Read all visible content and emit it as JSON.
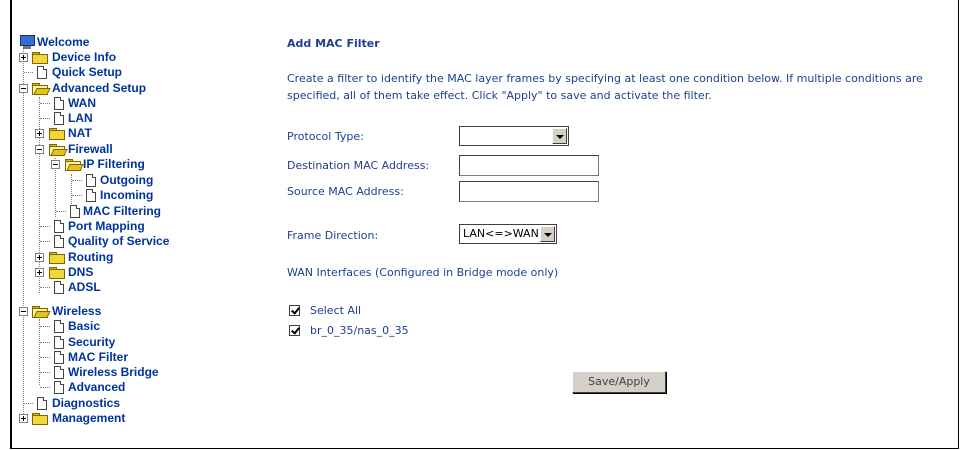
{
  "tree": {
    "welcome": "Welcome",
    "device_info": "Device Info",
    "quick_setup": "Quick Setup",
    "advanced_setup": "Advanced Setup",
    "wan": "WAN",
    "lan": "LAN",
    "nat": "NAT",
    "firewall": "Firewall",
    "ip_filtering": "IP Filtering",
    "outgoing": "Outgoing",
    "incoming": "Incoming",
    "mac_filtering": "MAC Filtering",
    "port_mapping": "Port Mapping",
    "qos": "Quality of Service",
    "routing": "Routing",
    "dns": "DNS",
    "adsl": "ADSL",
    "wireless": "Wireless",
    "basic": "Basic",
    "security": "Security",
    "mac_filter": "MAC Filter",
    "wireless_bridge": "Wireless Bridge",
    "advanced": "Advanced",
    "diagnostics": "Diagnostics",
    "management": "Management"
  },
  "form": {
    "title": "Add MAC Filter",
    "description": "Create a filter to identify the MAC layer frames by specifying at least one condition below. If multiple conditions are specified, all of them take effect. Click \"Apply\" to save and activate the filter.",
    "protocol_type_label": "Protocol Type:",
    "protocol_type_value": "",
    "dest_mac_label": "Destination MAC Address:",
    "dest_mac_value": "",
    "src_mac_label": "Source MAC Address:",
    "src_mac_value": "",
    "frame_direction_label": "Frame Direction:",
    "frame_direction_value": "LAN<=>WAN",
    "wan_interfaces_label": "WAN Interfaces (Configured in Bridge mode only)",
    "select_all_label": "Select All",
    "select_all_checked": true,
    "interface_label": "br_0_35/nas_0_35",
    "interface_checked": true,
    "save_apply_label": "Save/Apply"
  },
  "colors": {
    "link_text": "#003399",
    "content_text": "#1f3f8f",
    "button_face": "#d4d0c8"
  }
}
